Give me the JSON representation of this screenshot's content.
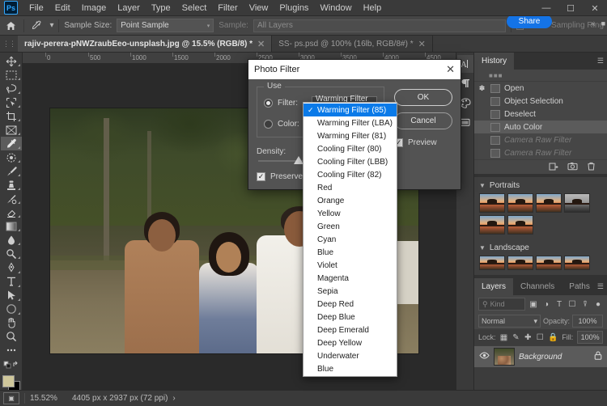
{
  "app": {
    "name": "Adobe Photoshop",
    "logo_text": "Ps"
  },
  "menubar": {
    "items": [
      "File",
      "Edit",
      "Image",
      "Layer",
      "Type",
      "Select",
      "Filter",
      "View",
      "Plugins",
      "Window",
      "Help"
    ]
  },
  "window_controls": {
    "minimize": "—",
    "maximize": "☐",
    "close": "✕"
  },
  "share": {
    "label": "Share"
  },
  "optionsbar": {
    "home_icon": "home-icon",
    "tool_icon": "eyedropper-icon",
    "sample_size_label": "Sample Size:",
    "sample_size_value": "Point Sample",
    "sample_label": "Sample:",
    "sample_value": "All Layers",
    "show_sampling_ring": "Show Sampling Ring"
  },
  "tabs": [
    {
      "label": "rajiv-perera-pNWZraubEeo-unsplash.jpg @ 15.5% (RGB/8) *",
      "active": true,
      "close": "✕"
    },
    {
      "label": "SS- ps.psd @ 100% (16lb, RGB/8#) *",
      "active": false,
      "close": "✕"
    }
  ],
  "toolbar": {
    "tools": [
      {
        "name": "move-tool",
        "active": false
      },
      {
        "name": "rectangular-marquee-tool",
        "active": false
      },
      {
        "name": "lasso-tool",
        "active": false
      },
      {
        "name": "object-selection-tool",
        "active": false
      },
      {
        "name": "crop-tool",
        "active": false
      },
      {
        "name": "frame-tool",
        "active": false
      },
      {
        "name": "eyedropper-tool",
        "active": true
      },
      {
        "name": "spot-healing-brush-tool",
        "active": false
      },
      {
        "name": "brush-tool",
        "active": false
      },
      {
        "name": "clone-stamp-tool",
        "active": false
      },
      {
        "name": "history-brush-tool",
        "active": false
      },
      {
        "name": "eraser-tool",
        "active": false
      },
      {
        "name": "gradient-tool",
        "active": false
      },
      {
        "name": "blur-tool",
        "active": false
      },
      {
        "name": "dodge-tool",
        "active": false
      },
      {
        "name": "pen-tool",
        "active": false
      },
      {
        "name": "type-tool",
        "active": false
      },
      {
        "name": "path-selection-tool",
        "active": false
      },
      {
        "name": "ellipse-tool",
        "active": false
      },
      {
        "name": "hand-tool",
        "active": false
      },
      {
        "name": "zoom-tool",
        "active": false
      },
      {
        "name": "edit-toolbar-tool",
        "active": false
      }
    ],
    "foreground_color": "#cfc79b",
    "background_color": "#000000"
  },
  "ruler": {
    "ticks": [
      "0",
      "500",
      "1000",
      "1500",
      "2000",
      "2500",
      "3000",
      "3500",
      "4000",
      "4500"
    ]
  },
  "dialog": {
    "title": "Photo Filter",
    "close": "✕",
    "use_legend": "Use",
    "filter_radio_label": "Filter:",
    "filter_value": "Warming Filter (85)",
    "color_radio_label": "Color:",
    "color_swatch": "#d8a268",
    "density_label": "Density:",
    "density_value": 25,
    "preserve_luminosity_label": "Preserve Luminosity",
    "preserve_luminosity_checked": true,
    "ok_label": "OK",
    "cancel_label": "Cancel",
    "preview_label": "Preview",
    "preview_checked": true,
    "caret": "⌄",
    "check_glyph": "✓"
  },
  "dropdown": {
    "selected": "Warming Filter (85)",
    "check_glyph": "✓",
    "items": [
      "Warming Filter (85)",
      "Warming Filter (LBA)",
      "Warming Filter (81)",
      "Cooling Filter (80)",
      "Cooling Filter (LBB)",
      "Cooling Filter (82)",
      "Red",
      "Orange",
      "Yellow",
      "Green",
      "Cyan",
      "Blue",
      "Violet",
      "Magenta",
      "Sepia",
      "Deep Red",
      "Deep Blue",
      "Deep Emerald",
      "Deep Yellow",
      "Underwater",
      "Blue"
    ]
  },
  "mini_dock": {
    "icons": [
      "character-panel-icon",
      "paragraph-panel-icon",
      "color-swatches-icon",
      "libraries-icon"
    ]
  },
  "history_panel": {
    "tab_label": "History",
    "menu_icon": "panel-menu-icon",
    "entries": [
      {
        "label": "Open",
        "state": "normal",
        "brush": true
      },
      {
        "label": "Object Selection",
        "state": "normal",
        "brush": false
      },
      {
        "label": "Deselect",
        "state": "normal",
        "brush": false
      },
      {
        "label": "Auto Color",
        "state": "selected",
        "brush": false
      },
      {
        "label": "Camera Raw Filter",
        "state": "dimmed",
        "brush": false
      },
      {
        "label": "Camera Raw Filter",
        "state": "dimmed",
        "brush": false
      }
    ],
    "footer_icons": [
      "create-document-from-state-icon",
      "create-snapshot-icon",
      "delete-state-icon"
    ]
  },
  "presets_panel": {
    "groups": [
      {
        "label": "Portraits",
        "expanded": true,
        "thumb_count": 6,
        "gray_index": 3
      },
      {
        "label": "Landscape",
        "expanded": true,
        "thumb_count": 4,
        "gray_index": -1
      }
    ]
  },
  "layers_panel": {
    "tabs": [
      "Layers",
      "Channels",
      "Paths"
    ],
    "active_tab": "Layers",
    "filter_placeholder": "Kind",
    "filter_icons": [
      "filter-pixel-icon",
      "filter-adjustment-icon",
      "filter-type-icon",
      "filter-shape-icon",
      "filter-smart-object-icon"
    ],
    "blend_mode": "Normal",
    "opacity_label": "Opacity:",
    "opacity_value": "100%",
    "lock_label": "Lock:",
    "lock_icons": [
      "lock-transparent-icon",
      "lock-image-icon",
      "lock-position-icon",
      "lock-artboard-icon",
      "lock-all-icon"
    ],
    "fill_label": "Fill:",
    "fill_value": "100%",
    "layers": [
      {
        "name": "Background",
        "visible": true,
        "locked": true,
        "eye_icon": "eye-icon",
        "lock_icon": "lock-icon"
      }
    ]
  },
  "statusbar": {
    "screen_mode_icon": "screen-mode-icon",
    "zoom_level": "15.52%",
    "doc_info": "4405 px x 2937 px (72 ppi)",
    "arrow": "›"
  }
}
